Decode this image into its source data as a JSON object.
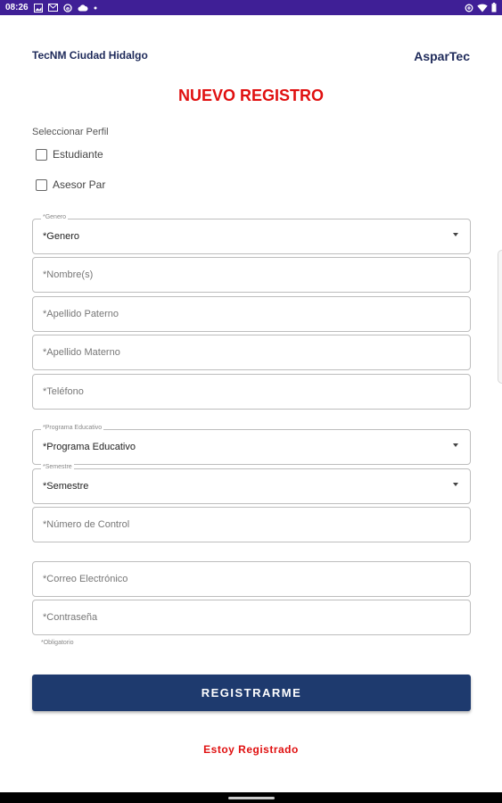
{
  "status_bar": {
    "time": "08:26",
    "bg_color": "#3f1f96",
    "left_icons": [
      "gallery-icon",
      "gmail-icon",
      "sync-icon",
      "cloud-icon",
      "dot-icon"
    ],
    "right_icons": [
      "data-saver-icon",
      "wifi-icon",
      "battery-icon"
    ]
  },
  "header": {
    "institution": "TecNM Ciudad Hidalgo",
    "app_name": "AsparTec"
  },
  "title": "NUEVO REGISTRO",
  "perfil": {
    "label": "Seleccionar Perfil",
    "options": [
      {
        "label": "Estudiante",
        "checked": false
      },
      {
        "label": "Asesor Par",
        "checked": false
      }
    ]
  },
  "form": {
    "genero": {
      "float_label": "*Genero",
      "value": "*Genero"
    },
    "nombre": {
      "placeholder": "*Nombre(s)"
    },
    "apellido_paterno": {
      "placeholder": "*Apellido Paterno"
    },
    "apellido_materno": {
      "placeholder": "*Apellido Materno"
    },
    "telefono": {
      "placeholder": "*Teléfono"
    },
    "programa": {
      "float_label": "*Programa Educativo",
      "value": "*Programa Educativo"
    },
    "semestre": {
      "float_label": "*Semestre",
      "value": "*Semestre"
    },
    "numero_control": {
      "placeholder": "*Número de Control"
    },
    "correo": {
      "placeholder": "*Correo Electrónico"
    },
    "contrasena": {
      "placeholder": "*Contraseña"
    },
    "hint": "*Obligatorio"
  },
  "buttons": {
    "register": "REGISTRARME",
    "already_registered": "Estoy Registrado"
  },
  "colors": {
    "accent_red": "#e01010",
    "primary_navy": "#1e3a6e"
  }
}
